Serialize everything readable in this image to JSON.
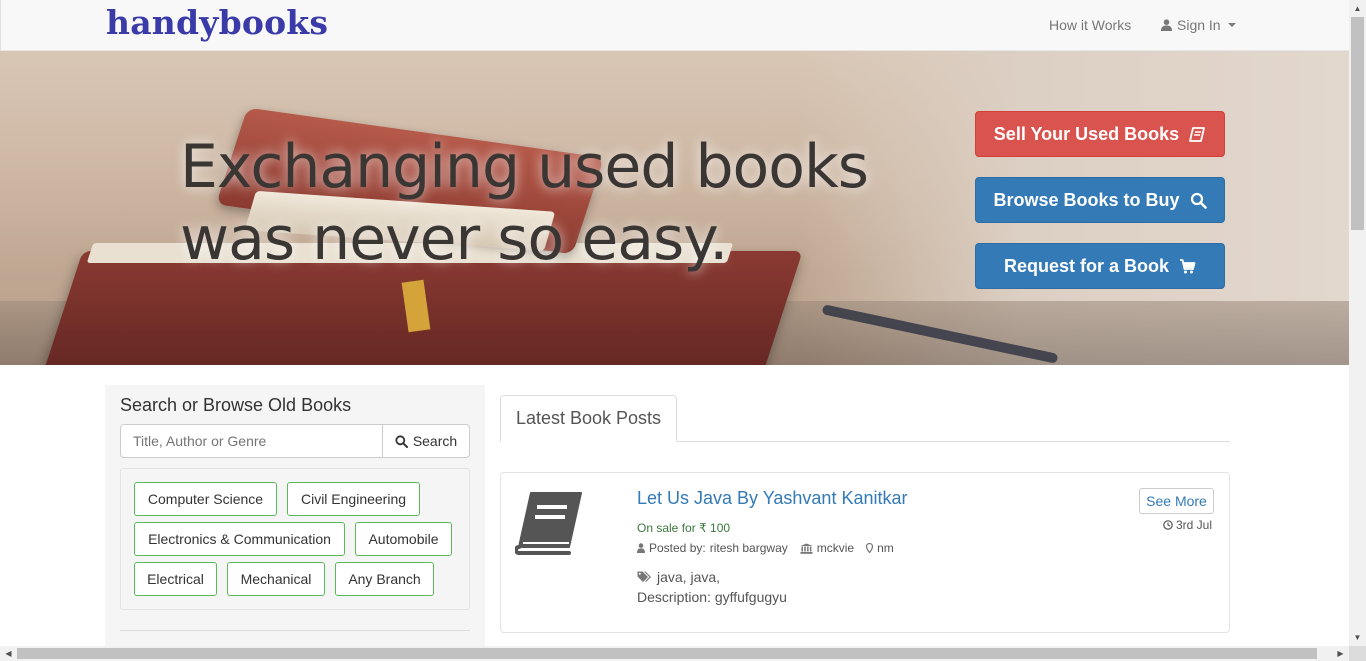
{
  "navbar": {
    "brand": "handybooks",
    "how_it_works": "How it Works",
    "sign_in": "Sign In"
  },
  "hero": {
    "title_line1": "Exchanging used books",
    "title_line2": "was never so easy.",
    "buttons": {
      "sell": "Sell Your Used Books",
      "browse": "Browse Books to Buy",
      "request": "Request for a Book"
    }
  },
  "search_panel": {
    "title": "Search or Browse Old Books",
    "placeholder": "Title, Author or Genre",
    "search_button": "Search",
    "tags": [
      "Computer Science",
      "Civil Engineering",
      "Electronics & Communication",
      "Automobile",
      "Electrical",
      "Mechanical",
      "Any Branch"
    ]
  },
  "latest": {
    "tab_label": "Latest Book Posts",
    "post": {
      "title": "Let Us Java By Yashvant Kanitkar",
      "sale_label": "On sale for",
      "price": "100",
      "posted_by_label": "Posted by:",
      "poster": "ritesh bargway",
      "college": "mckvie",
      "location": "nm",
      "tags": "java, java,",
      "description_label": "Description:",
      "description": "gyffufgugyu",
      "see_more": "See More",
      "date": "3rd Jul"
    }
  },
  "colors": {
    "brand": "#3a3aa8",
    "red_button": "#d9534f",
    "blue_button": "#337ab7",
    "tag_border": "#5cb85c"
  }
}
